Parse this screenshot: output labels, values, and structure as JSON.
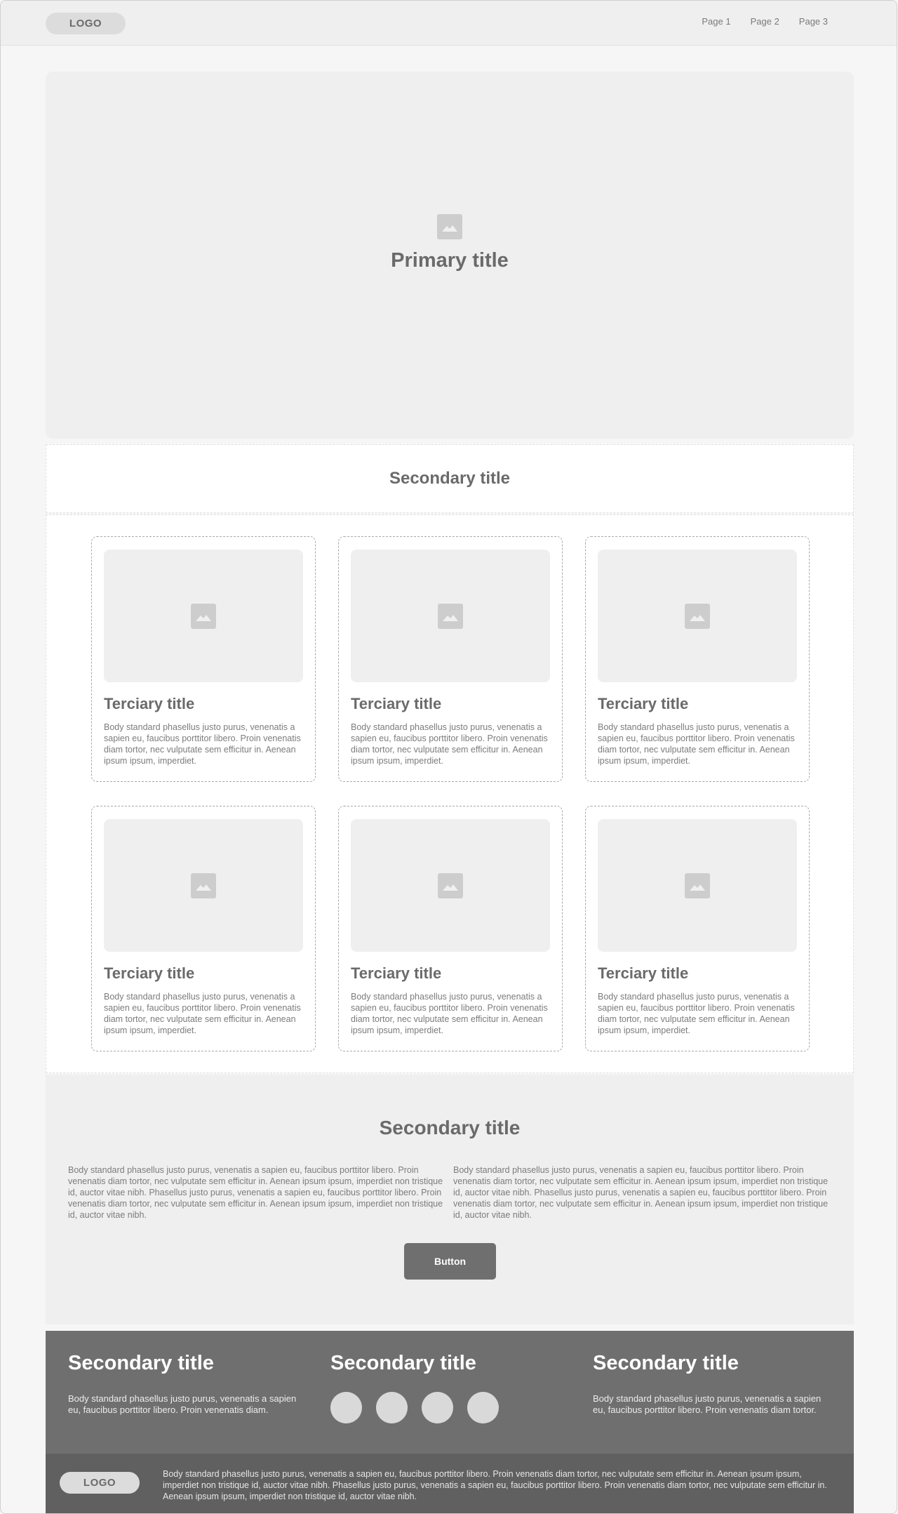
{
  "header": {
    "logo": "LOGO",
    "nav": [
      "Page 1",
      "Page 2",
      "Page 3"
    ]
  },
  "hero": {
    "title": "Primary title",
    "icon": "image-placeholder-icon"
  },
  "section1": {
    "title": "Secondary title"
  },
  "cards": [
    {
      "title": "Terciary title",
      "body": "Body standard phasellus justo purus, venenatis a sapien eu, faucibus porttitor libero. Proin venenatis diam tortor, nec vulputate sem efficitur in. Aenean ipsum ipsum, imperdiet."
    },
    {
      "title": "Terciary title",
      "body": "Body standard phasellus justo purus, venenatis a sapien eu, faucibus porttitor libero. Proin venenatis diam tortor, nec vulputate sem efficitur in. Aenean ipsum ipsum, imperdiet."
    },
    {
      "title": "Terciary title",
      "body": "Body standard phasellus justo purus, venenatis a sapien eu, faucibus porttitor libero. Proin venenatis diam tortor, nec vulputate sem efficitur in. Aenean ipsum ipsum, imperdiet."
    },
    {
      "title": "Terciary title",
      "body": "Body standard phasellus justo purus, venenatis a sapien eu, faucibus porttitor libero. Proin venenatis diam tortor, nec vulputate sem efficitur in. Aenean ipsum ipsum, imperdiet."
    },
    {
      "title": "Terciary title",
      "body": "Body standard phasellus justo purus, venenatis a sapien eu, faucibus porttitor libero. Proin venenatis diam tortor, nec vulputate sem efficitur in. Aenean ipsum ipsum, imperdiet."
    },
    {
      "title": "Terciary title",
      "body": "Body standard phasellus justo purus, venenatis a sapien eu, faucibus porttitor libero. Proin venenatis diam tortor, nec vulputate sem efficitur in. Aenean ipsum ipsum, imperdiet."
    }
  ],
  "section2": {
    "title": "Secondary title",
    "col1": "Body standard phasellus justo purus, venenatis a sapien eu, faucibus porttitor libero. Proin venenatis diam tortor, nec vulputate sem efficitur in. Aenean ipsum ipsum, imperdiet non tristique id, auctor vitae nibh. Phasellus justo purus, venenatis a sapien eu, faucibus porttitor libero. Proin venenatis diam tortor, nec vulputate sem efficitur in. Aenean ipsum ipsum, imperdiet non tristique id, auctor vitae nibh.",
    "col2": "Body standard phasellus justo purus, venenatis a sapien eu, faucibus porttitor libero. Proin venenatis diam tortor, nec vulputate sem efficitur in. Aenean ipsum ipsum, imperdiet non tristique id, auctor vitae nibh. Phasellus justo purus, venenatis a sapien eu, faucibus porttitor libero. Proin venenatis diam tortor, nec vulputate sem efficitur in. Aenean ipsum ipsum, imperdiet non tristique id, auctor vitae nibh.",
    "button": "Button"
  },
  "footer": {
    "col1": {
      "title": "Secondary title",
      "body": "Body standard phasellus justo purus, venenatis a sapien eu, faucibus porttitor libero. Proin venenatis diam."
    },
    "col2": {
      "title": "Secondary title"
    },
    "col3": {
      "title": "Secondary title",
      "body": "Body standard phasellus justo purus, venenatis a sapien eu, faucibus porttitor libero. Proin venenatis diam tortor."
    },
    "logo": "LOGO",
    "bottom_text": "Body standard phasellus justo purus, venenatis a sapien eu, faucibus porttitor libero. Proin venenatis diam tortor, nec vulputate sem efficitur in. Aenean ipsum ipsum, imperdiet non tristique id, auctor vitae nibh. Phasellus justo purus, venenatis a sapien eu, faucibus porttitor libero. Proin venenatis diam tortor, nec vulputate sem efficitur in. Aenean ipsum ipsum, imperdiet non tristique id, auctor vitae nibh."
  },
  "colors": {
    "panel": "#efefef",
    "footer": "#6f6f6f",
    "footer_bottom": "#606060",
    "button": "#6f6f6f"
  }
}
